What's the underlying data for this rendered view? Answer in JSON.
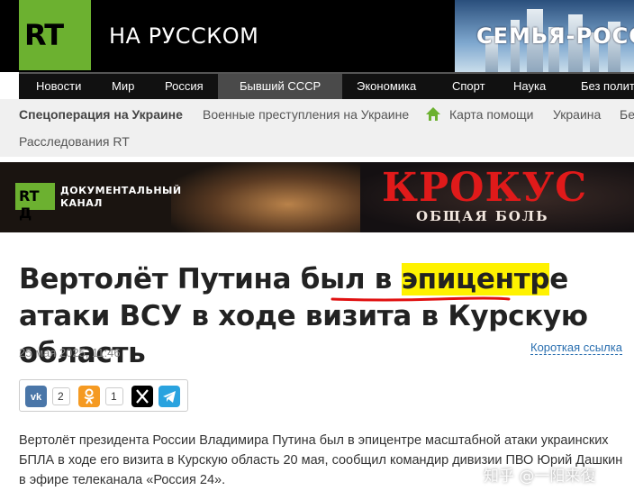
{
  "header": {
    "logo_text": "RT",
    "site_title": "НА РУССКОМ",
    "promo_text": "СЕМЬЯ-РОССИЯ"
  },
  "main_nav": [
    "Новости",
    "Мир",
    "Россия",
    "Бывший СССР",
    "Экономика",
    "Спорт",
    "Наука",
    "Без политики"
  ],
  "main_nav_active": "Бывший СССР",
  "sub_nav": {
    "row1": [
      "Спецоперация на Украине",
      "Военные преступления на Украине",
      "Карта помощи",
      "Украина",
      "Бе"
    ],
    "row2": [
      "Расследования RT"
    ]
  },
  "banner": {
    "channel_logo": "RT Д",
    "channel_line1": "ДОКУМЕНТАЛЬНЫЙ",
    "channel_line2": "КАНАЛ",
    "title": "КРОКУС",
    "subtitle": "ОБЩАЯ БОЛЬ"
  },
  "article": {
    "title_before": "Вертолёт Путина был в ",
    "title_highlight": "эпицентр",
    "title_after": "е атаки ВСУ в ходе визита в Курскую область",
    "date": "25 мая 2025, 11:46",
    "short_link": "Короткая ссылка",
    "lead": "Вертолёт президента России Владимира Путина был в эпицентре масштабной атаки украинских БПЛА в ходе его визита в Курскую область 20 мая, сообщил командир дивизии ПВО Юрий Дашкин в эфире телеканала «Россия 24»."
  },
  "share": {
    "vk_count": "2",
    "ok_count": "1"
  },
  "watermark": "知乎 @一阳来復",
  "colors": {
    "rt_green": "#6cb130",
    "highlight": "#fff200",
    "annotation_red": "#e01010",
    "krokus_red": "#e01a1a",
    "link_blue": "#2a6fb0"
  }
}
